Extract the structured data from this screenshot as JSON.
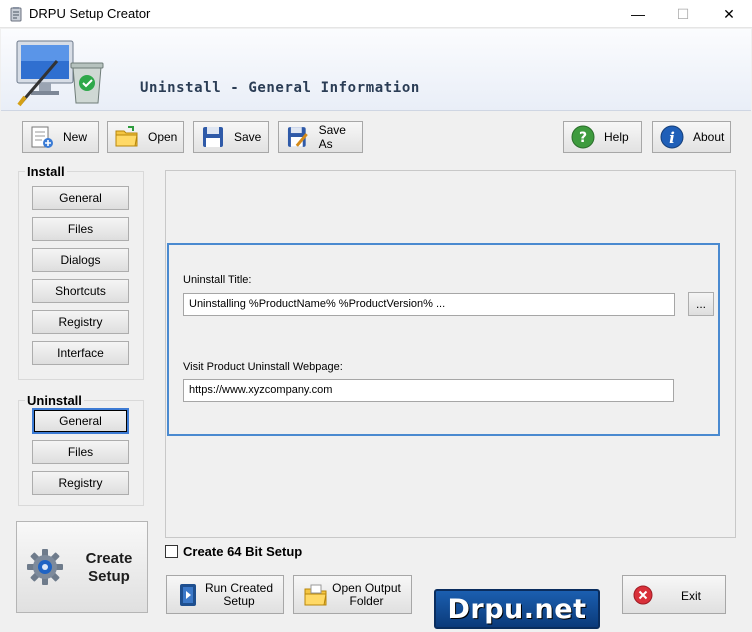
{
  "window": {
    "title": "DRPU Setup Creator",
    "minimize": "—",
    "maximize": "☐",
    "close": "✕"
  },
  "banner": {
    "heading": "Uninstall - General Information"
  },
  "toolbar": {
    "new_label": "New",
    "open_label": "Open",
    "save_label": "Save",
    "save_as_label": "Save As",
    "help_label": "Help",
    "about_label": "About"
  },
  "install": {
    "title": "Install",
    "items": [
      "General",
      "Files",
      "Dialogs",
      "Shortcuts",
      "Registry",
      "Interface"
    ]
  },
  "uninstall": {
    "title": "Uninstall",
    "items": [
      "General",
      "Files",
      "Registry"
    ],
    "active": "General"
  },
  "form": {
    "uninstall_title_label": "Uninstall Title:",
    "uninstall_title_value": "Uninstalling %ProductName% %ProductVersion% ...",
    "browse_label": "...",
    "webpage_label": "Visit Product Uninstall Webpage:",
    "webpage_value": "https://www.xyzcompany.com"
  },
  "create_setup": {
    "label_line1": "Create",
    "label_line2": "Setup"
  },
  "checkbox": {
    "label": "Create 64 Bit Setup",
    "checked": false
  },
  "bottom": {
    "run_line1": "Run Created",
    "run_line2": "Setup",
    "open_line1": "Open Output",
    "open_line2": "Folder",
    "exit_label": "Exit"
  },
  "brand": {
    "text": "Drpu.net"
  },
  "colors": {
    "accent": "#4a8ad0",
    "heading": "#2b3d55",
    "brand_bg": "#0b3a7a"
  }
}
